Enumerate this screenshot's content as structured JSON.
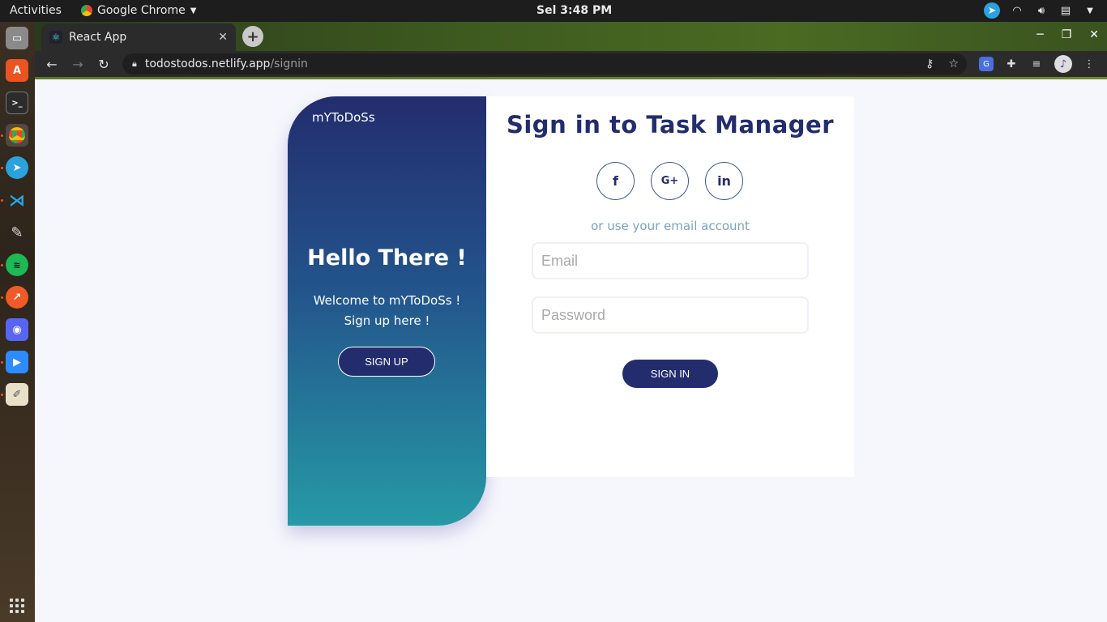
{
  "topbar": {
    "activities": "Activities",
    "app_name": "Google Chrome",
    "clock": "Sel  3:48 PM"
  },
  "dock": {
    "apps": [
      "files-icon",
      "software-center-icon",
      "terminal-icon",
      "chrome-icon",
      "telegram-icon",
      "vscode-icon",
      "inkscape-icon",
      "spotify-icon",
      "browser-icon",
      "discord-icon",
      "zoom-icon",
      "text-editor-icon"
    ]
  },
  "browser": {
    "tab_title": "React App",
    "url_host": "todostodos.netlify.app",
    "url_path": "/signin"
  },
  "left_panel": {
    "brand": "mYToDoSs",
    "heading": "Hello There !",
    "welcome_line1": "Welcome to mYToDoSs !",
    "welcome_line2": "Sign up here !",
    "signup_label": "SIGN UP"
  },
  "right_panel": {
    "title": "Sign in to Task Manager",
    "social": [
      "f",
      "G+",
      "in"
    ],
    "divider_text": "or use your email account",
    "email_placeholder": "Email",
    "password_placeholder": "Password",
    "signin_label": "SIGN IN"
  },
  "colors": {
    "primary": "#232d6e",
    "gradient_end": "#269aa6",
    "muted_text": "#7aa3bf"
  }
}
